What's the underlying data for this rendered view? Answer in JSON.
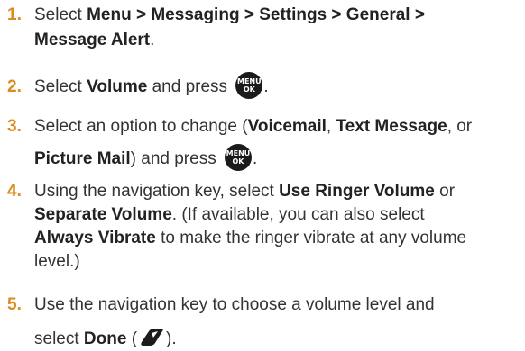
{
  "steps": [
    {
      "num": "1.",
      "lines": [
        [
          "Select ",
          {
            "b": "Menu > Messaging > Settings > General >"
          }
        ],
        [
          {
            "b": "Message Alert"
          },
          "."
        ]
      ]
    },
    {
      "num": "2.",
      "lines": [
        [
          "Select ",
          {
            "b": "Volume"
          },
          " and press ",
          {
            "icon": "menu-ok"
          },
          "."
        ]
      ]
    },
    {
      "num": "3.",
      "lines": [
        [
          "Select an option to change (",
          {
            "b": "Voicemail"
          },
          ", ",
          {
            "b": "Text Message"
          },
          ", or"
        ],
        [
          {
            "b": "Picture Mail"
          },
          ") and press ",
          {
            "icon": "menu-ok"
          },
          "."
        ]
      ]
    },
    {
      "num": "4.",
      "lines": [
        [
          "Using the navigation key, select ",
          {
            "b": "Use Ringer Volume"
          },
          " or"
        ],
        [
          {
            "b": "Separate Volume"
          },
          ". (If available, you can also select"
        ],
        [
          {
            "b": "Always Vibrate"
          },
          " to make the ringer vibrate at any volume"
        ],
        [
          "level.)"
        ]
      ]
    },
    {
      "num": "5.",
      "lines": [
        [
          "Use the navigation key to choose a volume level and"
        ],
        [
          "select ",
          {
            "b": "Done"
          },
          " (",
          {
            "icon": "softkey"
          },
          ")."
        ]
      ]
    }
  ],
  "icons": {
    "menu-ok": {
      "top": "MENU",
      "bottom": "OK"
    }
  }
}
